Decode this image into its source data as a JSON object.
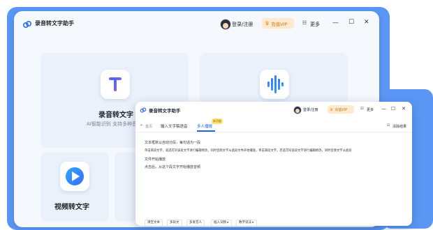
{
  "back_window": {
    "title": "录音转文字助手",
    "login_label": "登录/注册",
    "vip_label": "充值VIP",
    "more_label": "更多",
    "cards": {
      "record": {
        "title": "录音转文字",
        "desc": "AI智能识别 支持多种音频"
      },
      "video": {
        "title": "视频转文字"
      }
    }
  },
  "front_window": {
    "title": "录音转文字助手",
    "login_label": "登录/注册",
    "vip_label": "充值VIP",
    "more_label": "更多",
    "back_label": "首页",
    "tabs": [
      {
        "label": "输入文字稿语音"
      },
      {
        "label": "多人播报",
        "badge": "新功能"
      }
    ],
    "clear_label": "清除结果",
    "content_lines": [
      "文本框默认自动分段，每句话为一段",
      "单击某段文字，就选可对该段文字进行编辑修改，同时音频文字从此段文件开始播放。单击某段文字，若选可对该段文字进行编辑修改，同时音频文字从此段",
      "文件开始播放",
      "点击后，从这个段文字开始播放音频"
    ],
    "toolbar": [
      "清空文本",
      "多段文",
      "多发音人",
      "插入词频 ▸",
      "数字读法 ▸"
    ]
  },
  "colors": {
    "accent": "#1e63e9",
    "vip": "#ffe9cf",
    "backdrop": "#5a97f5"
  }
}
